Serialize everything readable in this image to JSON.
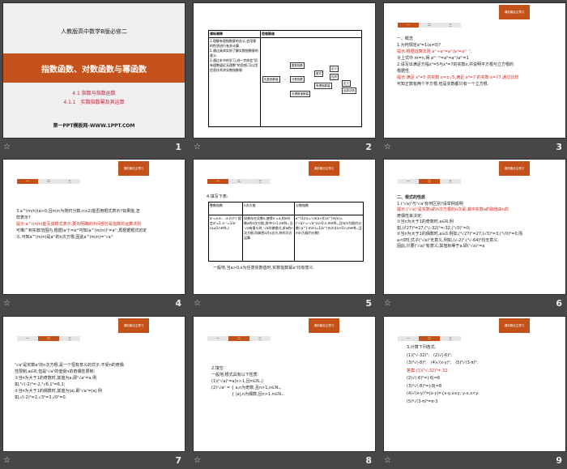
{
  "badge": "课前篇自主预习",
  "tabs": [
    "一",
    "二",
    "三"
  ],
  "slides": [
    {
      "number": "1",
      "subtitle": "人教版高中数学B版必修二",
      "title": "指数函数、对数函数与幂函数",
      "line1": "4.1 指数与指数函数",
      "line2": "4.1.1　实数指数幂及其运算",
      "site": "第一PPT模板网-WWW.1PPT.COM"
    },
    {
      "number": "2",
      "col1": "课标阐释",
      "col2": "思维脉络",
      "goals": [
        "1.理解有理指数幂的含义,会用幂的性质进行有关计算.",
        "2.通过具体实例了解实数指数幂的意义.",
        "3.通过本节的学习,进一步体会\"用有理数逼近无理数\"的思想,可以用信息技术求实数指数幂."
      ],
      "nodes": {
        "root": "实数指数幂",
        "n1": "整数指数",
        "n2": "分数指数",
        "n3": "无理数指数幂",
        "n4": "根式",
        "n5": "定义",
        "n6": "性质",
        "n7": "有理指数幂",
        "n8": "定义",
        "n9": "运算法则"
      }
    },
    {
      "number": "3",
      "lines": [
        "一、概念",
        "1.为何规定a⁰=1(a≠0)?",
        "提示:根据运算法则 aᵐ÷aⁿ=aᵐ/aⁿ=aᵐ⁻ⁿ,",
        "令上式中 m=n,得 aᵐ⁻ᵐ=a⁰=aᵐ/aᵐ=1",
        "2.请写出满足方程x²=5与x³=7的实数x,并说明平方根与立方根的",
        "根据性.",
        "提示:满足 x²=5 的实数 x=±√5,满足 x³=7 的实数 x=∛7,通过比较",
        "可知正数有两个平方根,但是实数都只有一个立方根."
      ]
    },
    {
      "number": "4",
      "lines": [
        "3.a^(m/n)(a>0,且m/n为既约分数,n≥2)能否用根式表示?如果能,怎",
        "样表示?",
        "提示:a^(m/n)能写成根式表示,要先明确的中间部分是指数的运算法则",
        "可推广到实数范围内,根据(aˢ)ᵗ=aˢᵗ可知(a^(m/n))ⁿ=aᵐ,再根据根式的定",
        "义,可知a^(m/n)是aᵐ的n次方根,因此a^(m/n)=ⁿ√aᵐ"
      ]
    },
    {
      "number": "5",
      "caption": "4.填写下表:",
      "headers": [
        "整数指数",
        "n次方根",
        "分数指数"
      ],
      "cells": [
        "aⁿ=a·a·…·a (n个)  规定a⁰=1  a⁻ⁿ=1/aⁿ (a≠0,n∈N₊)",
        "如果存在实数x,使得xⁿ=a,则x叫做a的n次方根,其中n>1,n∈N₊;当ⁿ√a有意义时,ⁿ√a叫做根式,求a的n次方根,叫做把a开n次方,称作开方运算",
        "a^(1/n)=ⁿ√a(a>0);a^(m/n)=(ⁿ√a)ᵐ=ⁿ√aᵐ(a>0,n,m∈N₊,且m/n为既约分数);a^(-m/n)=1/a^(m/n)(a>0,n,m∈N₊,且m/n为既约分数)"
      ],
      "note": "一般地,当a>0,x为任意实数值时,实数指数幂aˣ均有意义."
    },
    {
      "number": "6",
      "lines": [
        "二、根式的性质",
        "1.(ⁿ√a)ⁿ与ⁿ√aⁿ有何区别?请举例说明",
        "提示:(ⁿ√a)ⁿ是实数a的n次方根的n次幂,其中实数a的取值由n的",
        "奇偶性来决定:",
        "①当n为大于1的奇数时,a∈R.例",
        "如,(∛27)³=27,(⁵√-32)⁵=-32,(⁷√0)⁷=0;",
        "②当n为大于1的偶数时,a≥0.例如,(⁴√27)⁴=27,(√3)²=3,(⁴√0)⁴=0;而",
        "a<0时,式子(ⁿ√a)ⁿ无意义,例如,(√-2)²,(⁴√-64)⁴均无意义.",
        "因此,只要(ⁿ√a)ⁿ有意义,其值就等于a,即(ⁿ√a)ⁿ=a"
      ]
    },
    {
      "number": "7",
      "lines": [
        "ⁿ√aⁿ是实数aⁿ的n次方根,是一个恒有意义的式子,不受n的奇偶",
        "性限制,a∈R,但是ⁿ√aⁿ的值受n的奇偶性限制:",
        "①当n为大于1的奇数时,其值为a,即ⁿ√aⁿ=a.例",
        "如,³√(-2)³=-2,⁵√6.1⁵=6.1;",
        "②当n为大于1的偶数时,其值为|a|,即ⁿ√aⁿ=|a|.例",
        "如,√(-2)²=2,√3²=3,√0²=0."
      ]
    },
    {
      "number": "8",
      "lines": [
        "2.填空",
        "一般地,根式具有以下性质:",
        "(1)(ⁿ√a)ⁿ=a(n>1,且n∈N₊);",
        "(2)ⁿ√aⁿ = { a,n为奇数,且n>1,n∈N₊,",
        "　　　　　{ |a|,n为偶数,且n>1,n∈N₊."
      ]
    },
    {
      "number": "9",
      "lines": [
        "3.计算下列各式:",
        "(1)(⁵√-32)⁵;　(2)√(-6)²;",
        "(3)⁴√(-8)⁴;　(4)√(x-y)²;　(5)⁶√(3-π)⁶.",
        "答案:(1)(⁵√-32)⁵=-32",
        "(2)√(-6)²=|-6|=6",
        "(3)⁴√(-8)⁴=|-8|=8",
        "(4)√(x-y)²=|x-y|={x-y,x≥y; y-x,x<y.",
        "(5)⁶√(3-π)⁶=π-3"
      ]
    }
  ]
}
